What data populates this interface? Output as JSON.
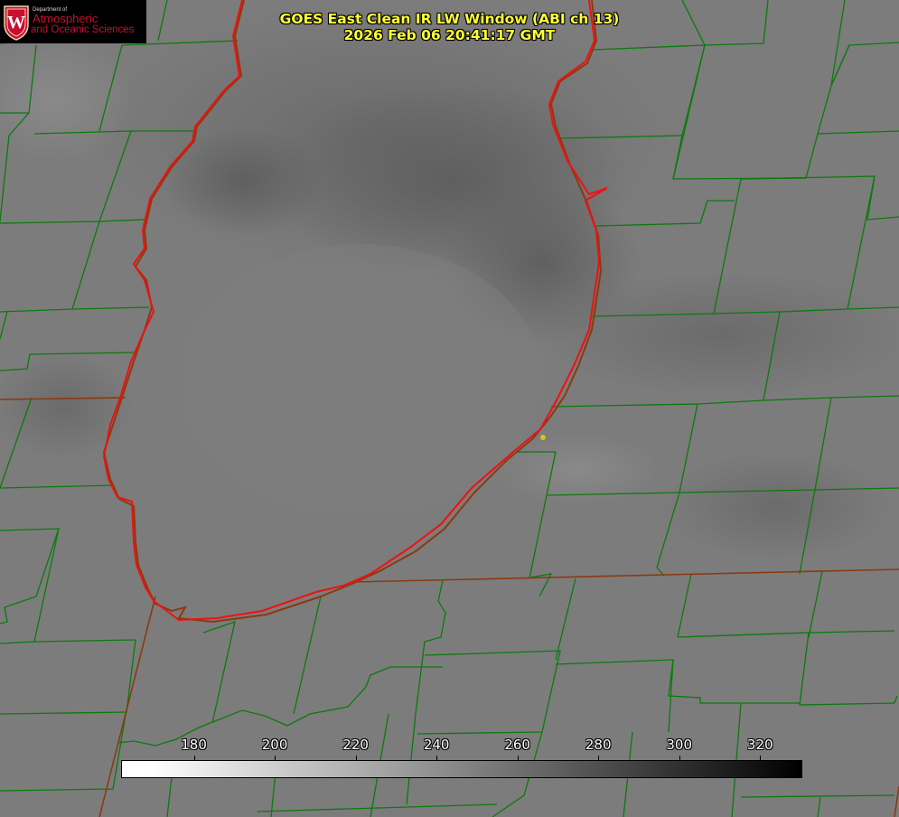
{
  "title": {
    "line1": "GOES East Clean IR LW Window (ABI ch 13)",
    "line2": "2026 Feb 06 20:41:17 GMT"
  },
  "logo": {
    "department": "Department of",
    "line1": "Atmospheric",
    "line2": "and Oceanic Sciences",
    "seal_letter": "W",
    "seal_color": "#c8102e"
  },
  "colorbar": {
    "min": 162,
    "max": 330,
    "ticks": [
      "180",
      "200",
      "220",
      "240",
      "260",
      "280",
      "300",
      "320"
    ],
    "gradient": "white-to-black"
  },
  "colors": {
    "county_lines": "#0c7a0c",
    "state_lines": "#8a3a12",
    "lake_shoreline": "#ee1111",
    "title_text": "#ffff33",
    "marker": "#d4c21a"
  },
  "marker": {
    "type": "station-dot"
  }
}
